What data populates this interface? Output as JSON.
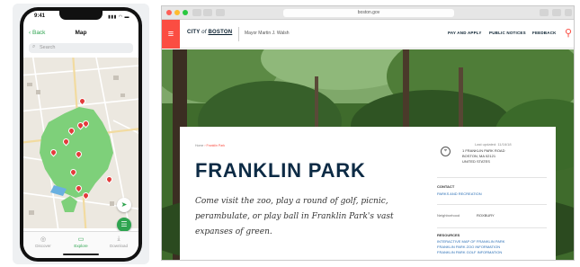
{
  "phone": {
    "status_time": "9:41",
    "status_icons": "▮▮▮ ◠ ▬",
    "back_label": "Back",
    "title": "Map",
    "search_placeholder": "Search",
    "tabs": [
      {
        "label": "Discover",
        "icon": "compass-icon"
      },
      {
        "label": "Explore",
        "icon": "map-icon"
      },
      {
        "label": "Download",
        "icon": "download-icon"
      }
    ],
    "active_tab": 1,
    "accent": "#2ea44f",
    "pin_color": "#e33b3b",
    "map_pin_count": 11
  },
  "browser": {
    "url": "boston.gov",
    "site": {
      "brand_city": "CITY",
      "brand_of": "of",
      "brand_name": "BOSTON",
      "mayor": "Mayor Martin J. Walsh",
      "nav": [
        "PAY AND APPLY",
        "PUBLIC NOTICES",
        "FEEDBACK"
      ],
      "accent": "#fb4d42"
    },
    "page": {
      "breadcrumb": [
        "Home",
        "Franklin Park"
      ],
      "updated": "Last updated: 11/16/18",
      "title": "FRANKLIN PARK",
      "lede": "Come visit the zoo, play a round of golf, picnic, perambulate, or play ball in Franklin Park's vast expanses of green.",
      "address": [
        "1 FRANKLIN PARK ROAD",
        "BOSTON, MA 02121",
        "UNITED STATES"
      ],
      "contact_label": "CONTACT",
      "contact_link": "PARKS AND RECREATION",
      "neighborhood_label": "Neighborhood",
      "neighborhood_value": "ROXBURY",
      "resources_label": "RESOURCES",
      "resources": [
        "INTERACTIVE MAP OF FRANKLIN PARK",
        "FRANKLIN PARK ZOO INFORMATION",
        "FRANKLIN PARK GOLF INFORMATION"
      ]
    }
  }
}
